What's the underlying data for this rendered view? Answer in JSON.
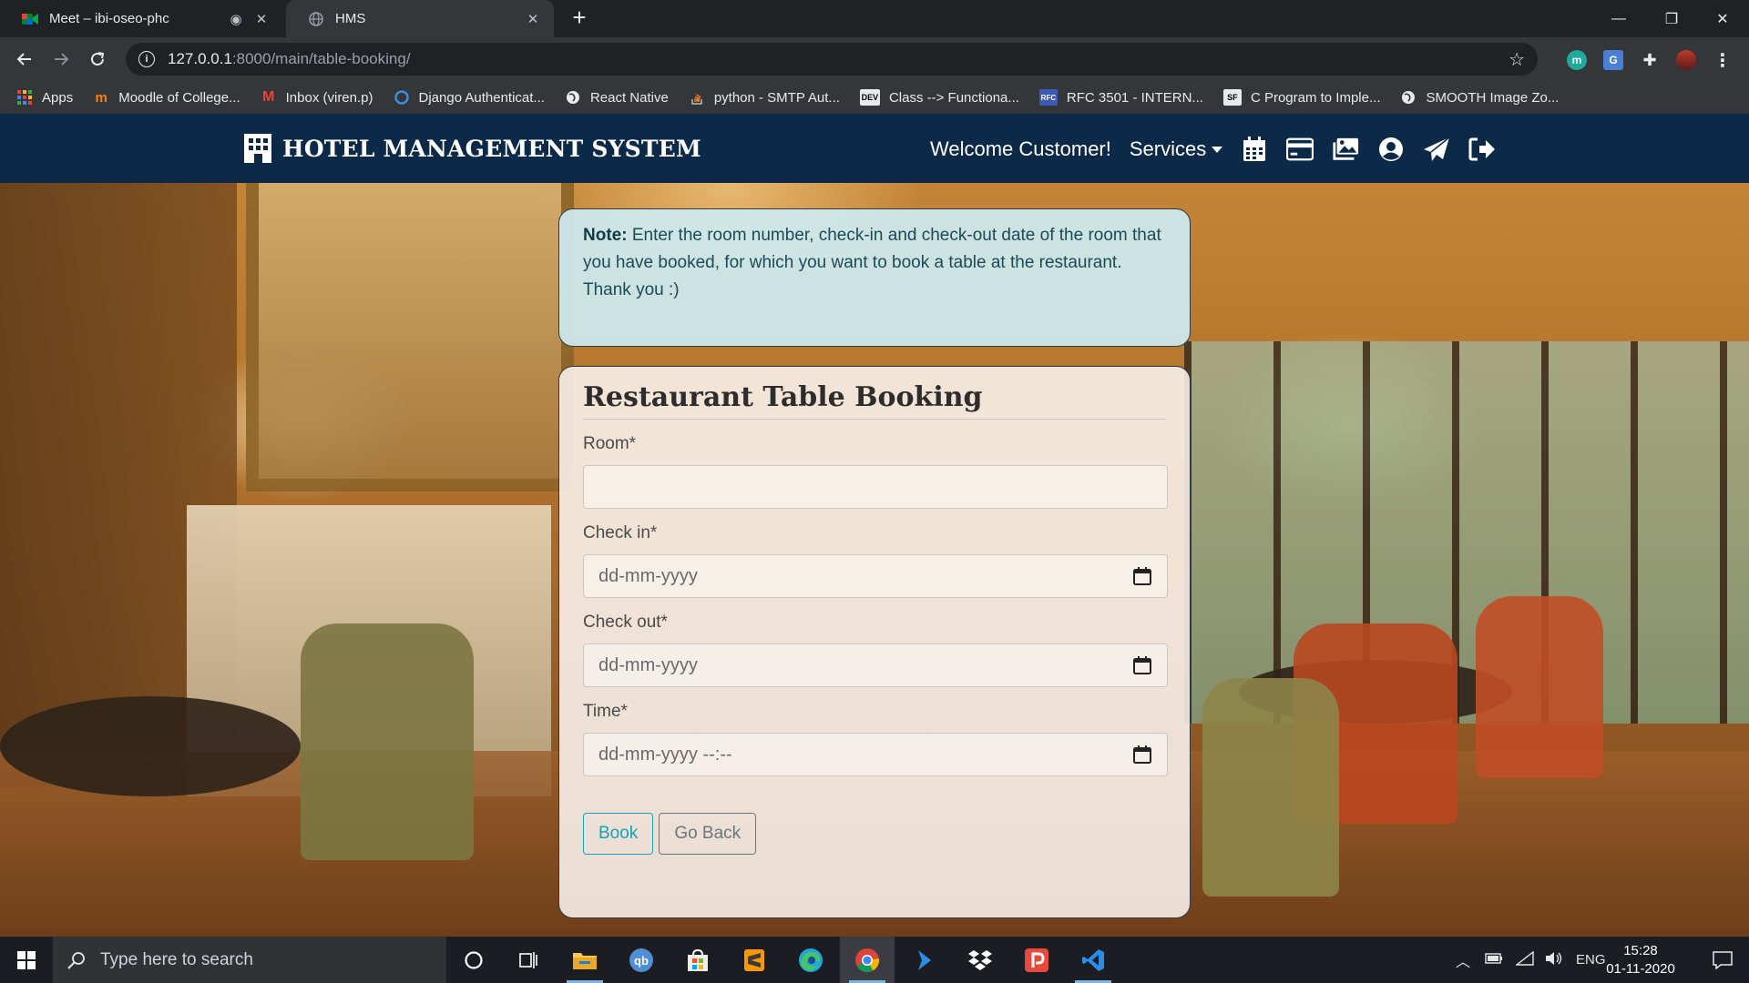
{
  "browser": {
    "tabs": [
      {
        "title": "Meet – ibi-oseo-phc",
        "active": false
      },
      {
        "title": "HMS",
        "active": true
      }
    ],
    "url_host": "127.0.0.1",
    "url_rest": ":8000/main/table-booking/",
    "bookmarks": [
      {
        "label": "Apps",
        "icon": "apps-grid-icon"
      },
      {
        "label": "Moodle of College...",
        "icon": "moodle-icon"
      },
      {
        "label": "Inbox (viren.p)",
        "icon": "gmail-icon"
      },
      {
        "label": "Django Authenticat...",
        "icon": "django-icon"
      },
      {
        "label": "React Native",
        "icon": "globe-icon"
      },
      {
        "label": "python - SMTP Aut...",
        "icon": "stackoverflow-icon"
      },
      {
        "label": "Class --> Functiona...",
        "icon": "dev-icon"
      },
      {
        "label": "RFC 3501 - INTERN...",
        "icon": "rfc-icon"
      },
      {
        "label": "C Program to Imple...",
        "icon": "sf-icon"
      },
      {
        "label": "SMOOTH Image Zo...",
        "icon": "globe-icon"
      }
    ],
    "bookmark_badges": {
      "dev": "DEV",
      "sf": "SF",
      "rfc": "RFC"
    }
  },
  "navbar": {
    "brand": "HOTEL MANAGEMENT SYSTEM",
    "welcome": "Welcome Customer!",
    "services": "Services",
    "icons": [
      "calendar-icon",
      "credit-card-icon",
      "images-icon",
      "user-circle-icon",
      "paper-plane-icon",
      "sign-out-icon"
    ]
  },
  "note": {
    "bold": "Note:",
    "text": "Enter the room number, check-in and check-out date of the room that you have booked, for which you want to book a table at the restaurant.",
    "thanks": "Thank you :)"
  },
  "form": {
    "title": "Restaurant Table Booking",
    "room_label": "Room*",
    "room_value": "",
    "checkin_label": "Check in*",
    "checkin_placeholder": "dd-mm-yyyy",
    "checkout_label": "Check out*",
    "checkout_placeholder": "dd-mm-yyyy",
    "time_label": "Time*",
    "time_placeholder": "dd-mm-yyyy --:--",
    "book_button": "Book",
    "back_button": "Go Back"
  },
  "taskbar": {
    "search_placeholder": "Type here to search",
    "apps": [
      "cortana-icon",
      "task-view-icon",
      "file-explorer-icon",
      "qbittorrent-icon",
      "store-icon",
      "sublime-icon",
      "edge-icon",
      "chrome-icon",
      "powershell-icon",
      "dropbox-icon",
      "pocket-casts-icon",
      "vscode-icon"
    ],
    "qb_label": "qb",
    "lang": "ENG",
    "time": "15:28",
    "date": "01-11-2020"
  },
  "colors": {
    "navbar": "#0c2a48",
    "book_button": "#17a2b8",
    "back_button": "#6c757d",
    "note_bg": "#cdebf0"
  }
}
